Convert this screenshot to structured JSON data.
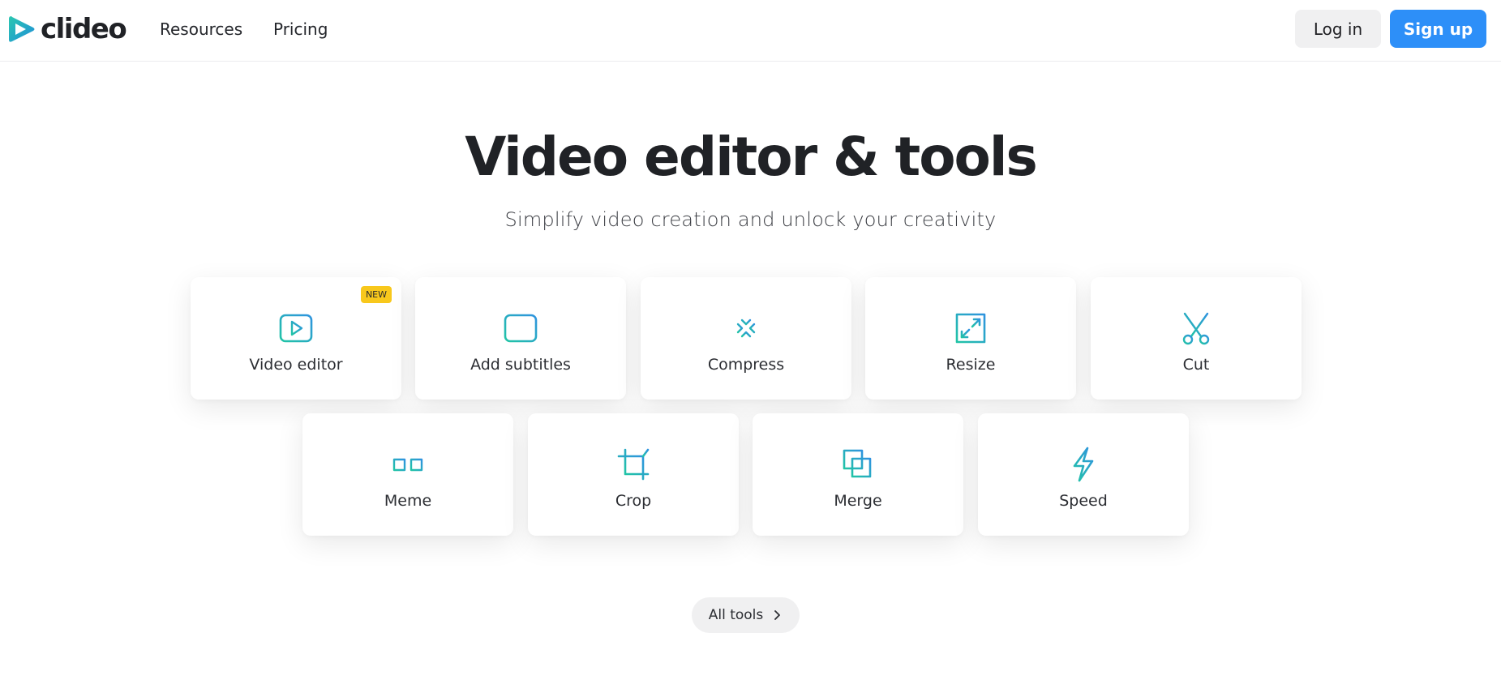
{
  "header": {
    "logo_text": "clideo",
    "nav": [
      {
        "label": "Resources"
      },
      {
        "label": "Pricing"
      }
    ],
    "login_label": "Log in",
    "signup_label": "Sign up"
  },
  "hero": {
    "title": "Video editor & tools",
    "subtitle": "Simplify video creation and unlock your creativity"
  },
  "tools": [
    {
      "label": "Video editor",
      "icon": "play-screen-icon",
      "badge": "NEW"
    },
    {
      "label": "Add subtitles",
      "icon": "subtitles-icon"
    },
    {
      "label": "Compress",
      "icon": "compress-arrows-icon"
    },
    {
      "label": "Resize",
      "icon": "resize-icon"
    },
    {
      "label": "Cut",
      "icon": "scissors-icon"
    },
    {
      "label": "Meme",
      "icon": "glasses-icon"
    },
    {
      "label": "Crop",
      "icon": "crop-icon"
    },
    {
      "label": "Merge",
      "icon": "merge-squares-icon"
    },
    {
      "label": "Speed",
      "icon": "lightning-icon"
    }
  ],
  "all_tools_label": "All tools",
  "colors": {
    "accent_blue": "#2d8ff8",
    "icon_teal": "#1fb8c4",
    "badge_yellow": "#f8c81c",
    "text_dark": "#202226"
  }
}
